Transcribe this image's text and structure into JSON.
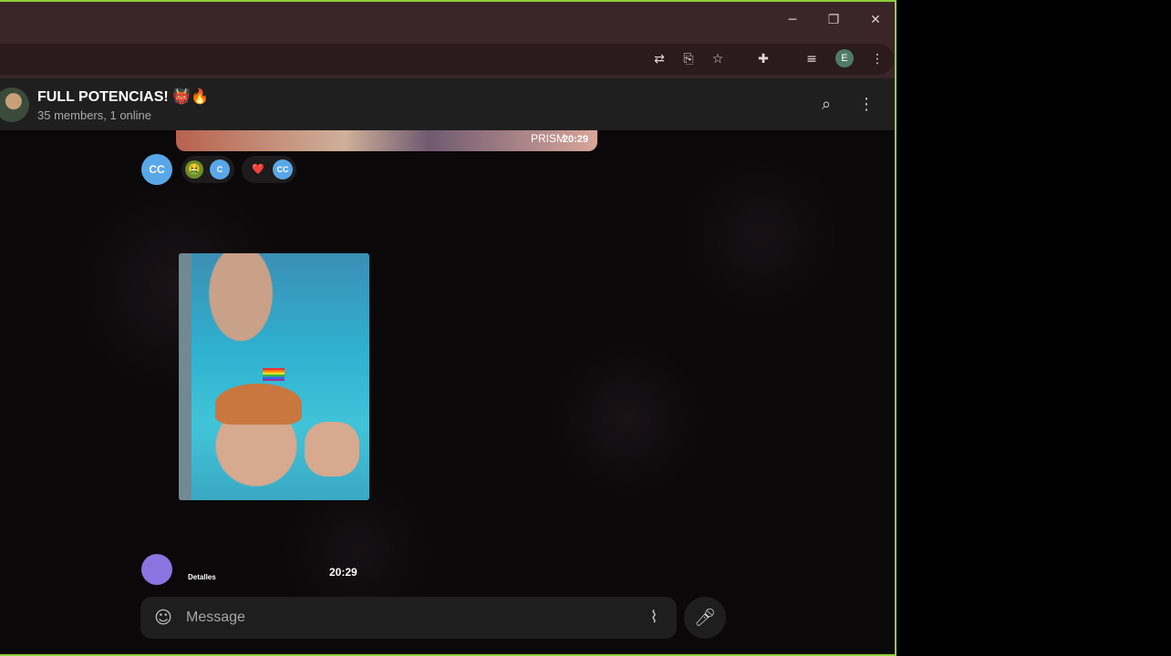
{
  "window_controls": {
    "minimize": "─",
    "restore": "❐",
    "close": "✕"
  },
  "toolbar": {
    "icons": [
      "translate-icon",
      "cast-icon",
      "star-icon",
      "extensions-icon",
      "media-icon",
      "profile-icon",
      "menu-icon"
    ],
    "profile_initial": "E"
  },
  "chat": {
    "title": "FULL POTENCIAS! 👹🔥",
    "subtitle": "35 members, 1 online"
  },
  "messages": {
    "previous_photo_text": "PRISM",
    "previous_time": "20:29",
    "reactions": [
      {
        "emoji": "🤮",
        "user": "C"
      },
      {
        "emoji": "❤️",
        "user": "CC"
      }
    ],
    "sender_avatar": "CC",
    "photo_caption": "Detalles",
    "photo_time": "20:29"
  },
  "composer": {
    "placeholder": "Message"
  }
}
